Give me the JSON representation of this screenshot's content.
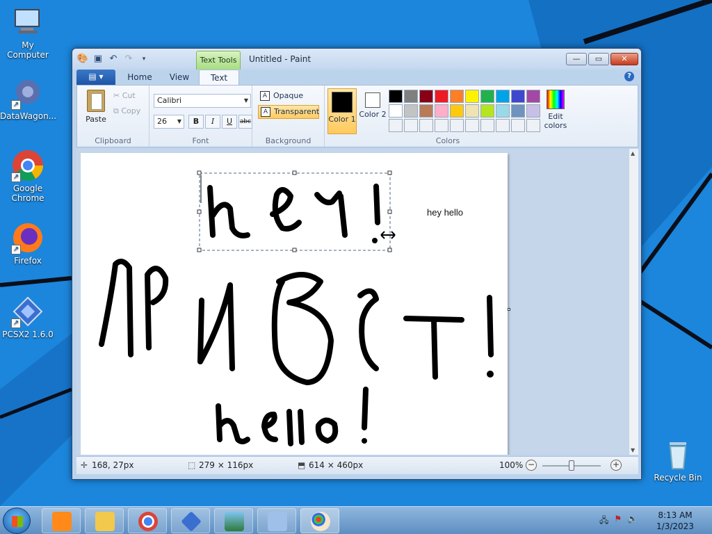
{
  "desktop": {
    "icons": [
      {
        "label": "My Computer"
      },
      {
        "label": "DataWagon..."
      },
      {
        "label": "Google Chrome"
      },
      {
        "label": "Firefox"
      },
      {
        "label": "PCSX2 1.6.0"
      },
      {
        "label": "Recycle Bin"
      }
    ]
  },
  "window": {
    "title": "Untitled - Paint",
    "context_tab": "Text Tools",
    "tabs": [
      {
        "label": "Home"
      },
      {
        "label": "View"
      },
      {
        "label": "Text"
      }
    ]
  },
  "ribbon": {
    "clipboard": {
      "label": "Clipboard",
      "paste": "Paste",
      "cut": "Cut",
      "copy": "Copy"
    },
    "font": {
      "label": "Font",
      "family": "Calibri",
      "size": "26",
      "bold": "B",
      "italic": "I",
      "underline": "U",
      "strike": "abc"
    },
    "background": {
      "label": "Background",
      "opaque": "Opaque",
      "transparent": "Transparent"
    },
    "colors": {
      "label": "Colors",
      "color1": "Color 1",
      "color2": "Color 2",
      "edit": "Edit colors",
      "color1_value": "#000000",
      "color2_value": "#ffffff",
      "palette": [
        "#000000",
        "#7f7f7f",
        "#880015",
        "#ed1c24",
        "#ff7f27",
        "#fff200",
        "#22b14c",
        "#00a2e8",
        "#3f48cc",
        "#a349a4",
        "#ffffff",
        "#c3c3c3",
        "#b97a57",
        "#ffaec9",
        "#ffc90e",
        "#efe4b0",
        "#b5e61d",
        "#99d9ea",
        "#7092be",
        "#c8bfe7",
        "#eef1f5",
        "#eef1f5",
        "#eef1f5",
        "#eef1f5",
        "#eef1f5",
        "#eef1f5",
        "#eef1f5",
        "#eef1f5",
        "#eef1f5",
        "#eef1f5"
      ]
    }
  },
  "canvas": {
    "typed_text": "hey hello"
  },
  "status": {
    "cursor": "168, 27px",
    "selection": "279 × 116px",
    "size": "614 × 460px",
    "zoom": "100%"
  },
  "taskbar": {
    "time": "8:13 AM",
    "date": "1/3/2023"
  }
}
